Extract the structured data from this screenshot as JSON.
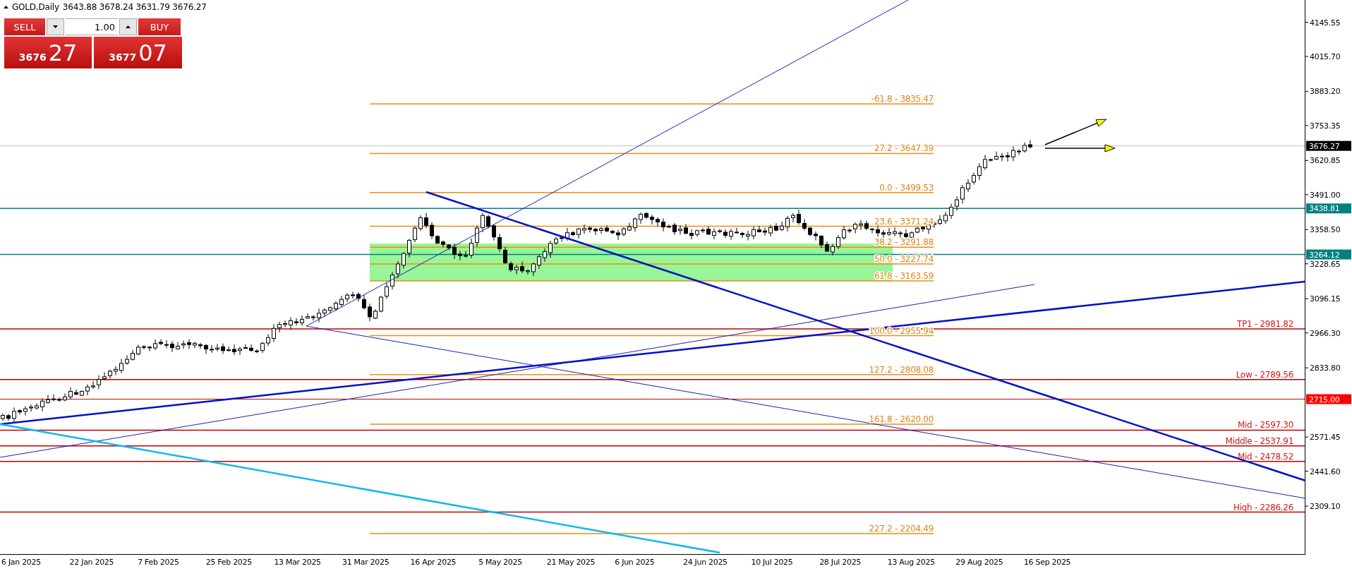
{
  "header": {
    "symbol": "GOLD,Daily",
    "ohlc": "3643.88 3678.24 3631.79 3676.27"
  },
  "trade_panel": {
    "sell_label": "SELL",
    "buy_label": "BUY",
    "volume": "1.00",
    "sell_price": {
      "main": "3676",
      "big": "27"
    },
    "buy_price": {
      "main": "3677",
      "big": "07"
    }
  },
  "fib_levels": [
    "-61.8 - 3835.47",
    "27.2 - 3647.39",
    "0.0 - 3499.53",
    "23.6 - 3371.24",
    "38.2 - 3291.88",
    "50.0 - 3227.74",
    "61.8 - 3163.59",
    "100.0 - 2955.94",
    "127.2 - 2808.08",
    "161.8 - 2620.00",
    "227.2 - 2204.49"
  ],
  "levels": [
    "TP1 - 2981.82",
    "Low - 2789.56",
    "Mid - 2597.30",
    "Middle - 2537.91",
    "Mid - 2478.52",
    "High - 2286.26"
  ],
  "price_axis": [
    "4145.55",
    "4015.70",
    "3883.20",
    "3753.35",
    "3620.85",
    "3491.00",
    "3358.50",
    "3228.65",
    "3096.15",
    "2966.30",
    "2833.80",
    "2571.45",
    "2441.60",
    "2309.10"
  ],
  "price_tags": [
    {
      "text": "3676.27",
      "color": "#000000"
    },
    {
      "text": "3438.81",
      "color": "#008080"
    },
    {
      "text": "3264.12",
      "color": "#008080"
    },
    {
      "text": "2715.00",
      "color": "#ff0000"
    }
  ],
  "time_axis": [
    "6 Jan 2025",
    "22 Jan 2025",
    "7 Feb 2025",
    "25 Feb 2025",
    "13 Mar 2025",
    "31 Mar 2025",
    "16 Apr 2025",
    "5 May 2025",
    "21 May 2025",
    "6 Jun 2025",
    "24 Jun 2025",
    "10 Jul 2025",
    "28 Jul 2025",
    "13 Aug 2025",
    "29 Aug 2025",
    "16 Sep 2025"
  ]
}
